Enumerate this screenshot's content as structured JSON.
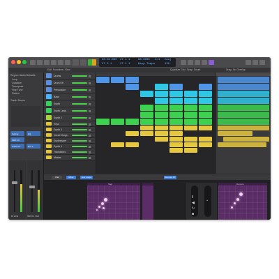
{
  "lcd": {
    "row1": [
      "00:04:680",
      "27  1  1",
      "96.0000",
      "4/4",
      "Cmaj"
    ],
    "row2": [
      "27  5  1",
      "27  1  1",
      "Keep Tempo",
      "120"
    ]
  },
  "subbar": [
    "Edit",
    "Functions",
    "View",
    "Quantize Grid",
    "Snap",
    "Smart",
    "Drag",
    "No Overlap"
  ],
  "inspector": {
    "header": "Region: Audio Defaults",
    "lines": [
      "Loop",
      "Quantize",
      "Transpose",
      "Fine Tune",
      "Flatten"
    ],
    "track_label": "Track: Drums",
    "buttons": [
      "Setting",
      "EQ",
      "MIDI FX",
      "Audio FX",
      "Bus 1"
    ],
    "strip_names": [
      "Drums",
      "Stereo Out"
    ]
  },
  "tracks": [
    {
      "name": "Drums",
      "color": "#5c8ee0"
    },
    {
      "name": "Drum Kit",
      "color": "#5c8ee0"
    },
    {
      "name": "Percussion",
      "color": "#5c8ee0"
    },
    {
      "name": "Bass",
      "color": "#47b3ff"
    },
    {
      "name": "Synth",
      "color": "#35d15b"
    },
    {
      "name": "Synth Lead",
      "color": "#35d15b"
    },
    {
      "name": "Synth 2",
      "color": "#a8d13a"
    },
    {
      "name": "Keys",
      "color": "#e5c63a"
    },
    {
      "name": "Synth 3",
      "color": "#e5c63a"
    },
    {
      "name": "Vocal Chops",
      "color": "#e5c63a"
    },
    {
      "name": "Synthesizer",
      "color": "#e5c63a"
    },
    {
      "name": "Synth 4",
      "color": "#e5c63a"
    },
    {
      "name": "Transitions",
      "color": "#e5c63a"
    },
    {
      "name": "Master",
      "color": "#e5c63a"
    }
  ],
  "editor": {
    "tabs": [
      "Pad",
      "Mixer",
      "Live Loops"
    ],
    "pad_left": "Step",
    "pad_right": "Remote",
    "mode_label": "Remote FX",
    "accent": "#3d7de0"
  },
  "colors": {
    "blue": "#4f95e8",
    "cyan": "#2ec7e6",
    "green": "#3ed14f",
    "yellow": "#e6c840",
    "pad": "#5a2d66"
  }
}
